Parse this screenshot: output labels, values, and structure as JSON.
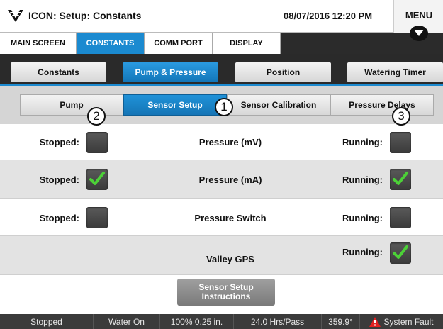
{
  "header": {
    "title": "ICON: Setup: Constants",
    "datetime": "08/07/2016 12:20 PM",
    "menu_label": "MENU"
  },
  "main_nav": {
    "tabs": [
      {
        "label": "MAIN SCREEN",
        "active": false
      },
      {
        "label": "CONSTANTS",
        "active": true
      },
      {
        "label": "COMM PORT",
        "active": false
      },
      {
        "label": "DISPLAY",
        "active": false
      }
    ]
  },
  "sub_nav": {
    "tabs": [
      {
        "label": "Constants",
        "active": false
      },
      {
        "label": "Pump & Pressure",
        "active": true
      },
      {
        "label": "Position",
        "active": false
      },
      {
        "label": "Watering Timer",
        "active": false
      }
    ]
  },
  "third_nav": {
    "tabs": [
      {
        "label": "Pump",
        "active": false
      },
      {
        "label": "Sensor Setup",
        "active": true
      },
      {
        "label": "Sensor Calibration",
        "active": false
      },
      {
        "label": "Pressure Delays",
        "active": false
      }
    ]
  },
  "callouts": [
    "1",
    "2",
    "3"
  ],
  "rows": [
    {
      "stopped_label": "Stopped:",
      "stopped_checked": false,
      "name": "Pressure (mV)",
      "running_label": "Running:",
      "running_checked": false
    },
    {
      "stopped_label": "Stopped:",
      "stopped_checked": true,
      "name": "Pressure (mA)",
      "running_label": "Running:",
      "running_checked": true
    },
    {
      "stopped_label": "Stopped:",
      "stopped_checked": false,
      "name": "Pressure Switch",
      "running_label": "Running:",
      "running_checked": false
    },
    {
      "name": "Valley GPS",
      "running_label": "Running:",
      "running_checked": true
    }
  ],
  "instructions_button": {
    "line1": "Sensor Setup",
    "line2": "Instructions"
  },
  "status_bar": {
    "state": "Stopped",
    "water": "Water On",
    "percent_depth": "100% 0.25 in.",
    "hrs_pass": "24.0 Hrs/Pass",
    "angle": "359.9°",
    "fault": "System Fault"
  },
  "colors": {
    "accent": "#1b8ad0",
    "check": "#4cd137",
    "fault": "#e02020"
  }
}
